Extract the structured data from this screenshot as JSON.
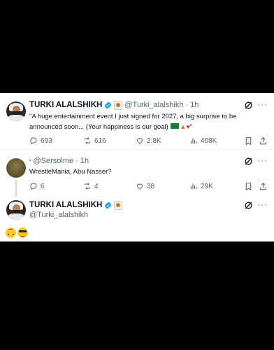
{
  "tweet1": {
    "name": "TURKI ALALSHIKH",
    "handle": "@Turki_alalshikh · 1h",
    "text": "\"A huge entertainment event I just signed for 2027, a big surprise to be announced soon... (Your happiness is our goal) ",
    "text_end": "\"",
    "replies": "693",
    "reposts": "616",
    "likes": "2.8K",
    "views": "408K"
  },
  "tweet2": {
    "handle": "@Sersolme · 1h",
    "text": "WrestleMania, Abu Nasser?",
    "replies": "6",
    "reposts": "4",
    "likes": "38",
    "views": "29K"
  },
  "tweet3": {
    "name": "TURKI ALALSHIKH",
    "handle": "@Turki_alalshikh"
  },
  "colors": {
    "verified": "#1d9bf0",
    "muted": "#536471",
    "background": "#000000"
  },
  "icons": [
    "verified-badge",
    "grok-icon",
    "more-icon",
    "reply-icon",
    "repost-icon",
    "like-icon",
    "views-icon",
    "bookmark-icon",
    "share-icon"
  ]
}
